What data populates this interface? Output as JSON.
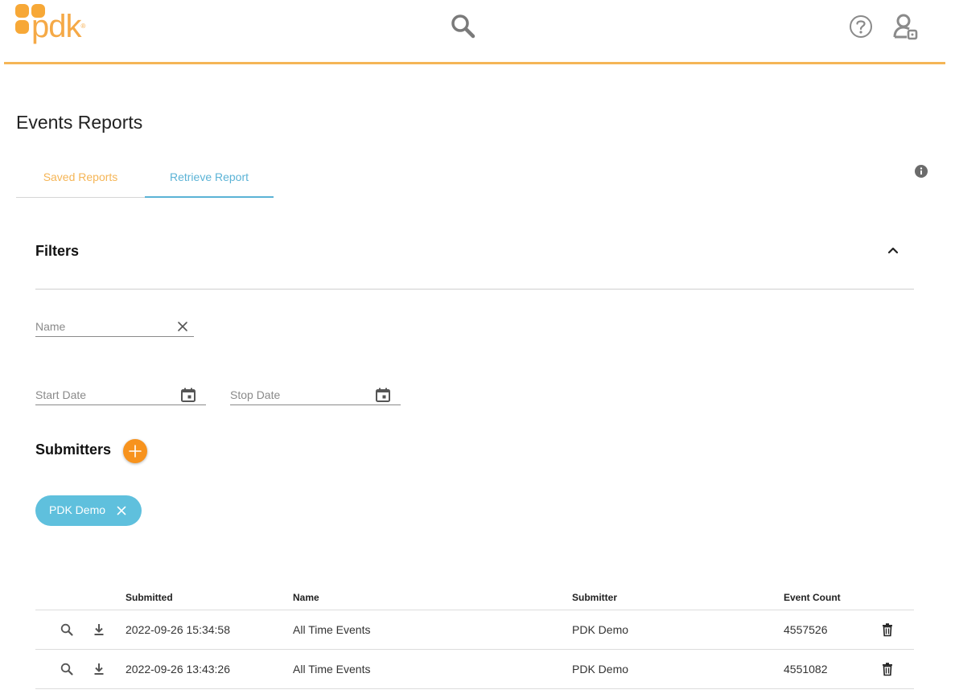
{
  "header": {
    "logo_text": "pdk",
    "logo_mark": "®",
    "icons": [
      "search-icon",
      "help-icon",
      "user-settings-icon"
    ]
  },
  "page": {
    "title": "Events Reports"
  },
  "tabs": [
    {
      "label": "Saved Reports",
      "active": false
    },
    {
      "label": "Retrieve Report",
      "active": true
    }
  ],
  "filters": {
    "title": "Filters",
    "name_placeholder": "Name",
    "name_value": "",
    "start_date_placeholder": "Start Date",
    "start_date_value": "",
    "stop_date_placeholder": "Stop Date",
    "stop_date_value": ""
  },
  "submitters": {
    "title": "Submitters",
    "chips": [
      {
        "label": "PDK Demo"
      }
    ]
  },
  "table": {
    "columns": [
      "Submitted",
      "Name",
      "Submitter",
      "Event Count"
    ],
    "rows": [
      {
        "submitted": "2022-09-26 15:34:58",
        "name": "All Time Events",
        "submitter": "PDK Demo",
        "event_count": "4557526"
      },
      {
        "submitted": "2022-09-26 13:43:26",
        "name": "All Time Events",
        "submitter": "PDK Demo",
        "event_count": "4551082"
      }
    ]
  },
  "colors": {
    "brand_orange": "#f7a837",
    "accent_orange": "#f7931e",
    "tab_active_blue": "#5bb3d6",
    "chip_blue": "#5fc0dd",
    "header_line": "#f5b556"
  }
}
